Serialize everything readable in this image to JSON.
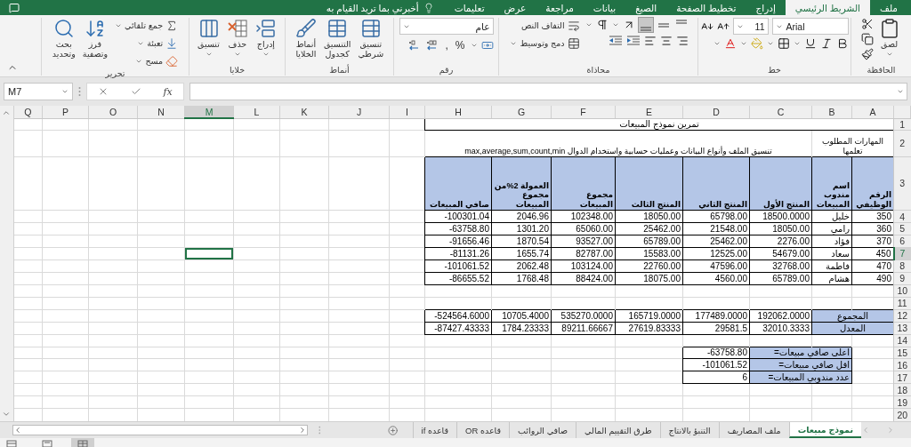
{
  "ribbon_tabs": [
    {
      "label": "ملف",
      "selected": false
    },
    {
      "label": "الشريط الرئيسي",
      "selected": true
    },
    {
      "label": "إدراج",
      "selected": false
    },
    {
      "label": "تخطيط الصفحة",
      "selected": false
    },
    {
      "label": "الصيغ",
      "selected": false
    },
    {
      "label": "بيانات",
      "selected": false
    },
    {
      "label": "مراجعة",
      "selected": false
    },
    {
      "label": "عرض",
      "selected": false
    },
    {
      "label": "تعليمات",
      "selected": false
    }
  ],
  "tell_me": "أخبرني بما تريد القيام به",
  "ribbon": {
    "clipboard": {
      "label": "الحافظة",
      "paste": "لصق"
    },
    "font": {
      "label": "خط",
      "name": "Arial",
      "size": "11"
    },
    "alignment": {
      "label": "محاذاة",
      "wrap": "التفاف النص",
      "merge": "دمج وتوسيط",
      "vertical_align": [
        {
          "selected": false
        },
        {
          "selected": false
        },
        {
          "selected": true
        }
      ]
    },
    "number": {
      "label": "رقم",
      "format": "عام",
      "percent": "%",
      "comma": ","
    },
    "styles": {
      "label": "أنماط",
      "buttons": [
        "تنسيق\nشرطي",
        "التنسيق\nكجدول",
        "أنماط\nالخلايا"
      ]
    },
    "cells": {
      "label": "خلايا",
      "buttons": [
        "إدراج",
        "حذف",
        "تنسيق"
      ]
    },
    "editing": {
      "label": "تحرير",
      "autosum": "جمع تلقائي",
      "fill": "تعبئة",
      "clear": "مسح",
      "sort": "فرز\nوتصفية",
      "find": "بحث\nوتحديد"
    }
  },
  "formula_bar": {
    "name_box": "M7",
    "fx": "fx"
  },
  "sheet": {
    "columns": [
      {
        "label": "A",
        "selected": false
      },
      {
        "label": "B",
        "selected": false
      },
      {
        "label": "C",
        "selected": false
      },
      {
        "label": "D",
        "selected": false
      },
      {
        "label": "E",
        "selected": false
      },
      {
        "label": "F",
        "selected": false
      },
      {
        "label": "G",
        "selected": false
      },
      {
        "label": "H",
        "selected": false
      },
      {
        "label": "I",
        "selected": false
      },
      {
        "label": "J",
        "selected": false
      },
      {
        "label": "K",
        "selected": false
      },
      {
        "label": "L",
        "selected": false
      },
      {
        "label": "M",
        "selected": true
      },
      {
        "label": "N",
        "selected": false
      },
      {
        "label": "O",
        "selected": false
      },
      {
        "label": "P",
        "selected": false
      },
      {
        "label": "Q",
        "selected": false
      }
    ],
    "rows": [
      {
        "label": "1",
        "selected": false
      },
      {
        "label": "2",
        "selected": false
      },
      {
        "label": "3",
        "selected": false
      },
      {
        "label": "4",
        "selected": false
      },
      {
        "label": "5",
        "selected": false
      },
      {
        "label": "6",
        "selected": false
      },
      {
        "label": "7",
        "selected": true
      },
      {
        "label": "8",
        "selected": false
      },
      {
        "label": "9",
        "selected": false
      },
      {
        "label": "10",
        "selected": false
      },
      {
        "label": "11",
        "selected": false
      },
      {
        "label": "12",
        "selected": false
      },
      {
        "label": "13",
        "selected": false
      },
      {
        "label": "14",
        "selected": false
      },
      {
        "label": "15",
        "selected": false
      },
      {
        "label": "16",
        "selected": false
      },
      {
        "label": "17",
        "selected": false
      },
      {
        "label": "18",
        "selected": false
      },
      {
        "label": "19",
        "selected": false
      },
      {
        "label": "20",
        "selected": false
      }
    ],
    "title": "تمرين نموذج المبيعات",
    "skills_label": "المهارات المطلوب تعلمها",
    "skills_text": "تنسيق الملف وأنواع البيانات وعمليات حسابية واستخدام الدوال max,average,sum,count,min",
    "headers": [
      "الرقم الوظيفي",
      "اسم مندوب المبيعات",
      "المنتج الأول",
      "المنتج الثاني",
      "المنتج الثالث",
      "مجموع المبيعات",
      "العمولة 2%من مجموع المبيعات",
      "صافي المبيعات"
    ],
    "data": [
      [
        "350",
        "خليل",
        "18500.0000",
        "65798.00",
        "18050.00",
        "102348.00",
        "2046.96",
        "-100301.04"
      ],
      [
        "360",
        "رامي",
        "18050.00",
        "21548.00",
        "25462.00",
        "65060.00",
        "1301.20",
        "-63758.80"
      ],
      [
        "370",
        "فؤاد",
        "2276.00",
        "25462.00",
        "65789.00",
        "93527.00",
        "1870.54",
        "-91656.46"
      ],
      [
        "450",
        "سعاد",
        "54679.00",
        "12525.00",
        "15583.00",
        "82787.00",
        "1655.74",
        "-81131.26"
      ],
      [
        "470",
        "فاطمة",
        "32768.00",
        "47596.00",
        "22760.00",
        "103124.00",
        "2062.48",
        "-101061.52"
      ],
      [
        "490",
        "هشام",
        "65789.00",
        "4560.00",
        "18075.00",
        "88424.00",
        "1768.48",
        "-86655.52"
      ]
    ],
    "totals": [
      {
        "label": "المجموع",
        "values": [
          "192062.0000",
          "177489.0000",
          "165719.0000",
          "535270.0000",
          "10705.4000",
          "-524564.6000"
        ]
      },
      {
        "label": "المعدل",
        "values": [
          "32010.3333",
          "29581.5",
          "27619.83333",
          "89211.66667",
          "1784.23333",
          "-87427.43333"
        ]
      }
    ],
    "summary": [
      {
        "label": "اعلى صافي مبيعات=",
        "value": "-63758.80"
      },
      {
        "label": "اقل صافي مبيعات=",
        "value": "-101061.52"
      },
      {
        "label": "عدد مندوبي المبيعات=",
        "value": "6"
      }
    ]
  },
  "sheet_tabs": [
    {
      "label": "نموذج مبيعات",
      "selected": true
    },
    {
      "label": "ملف المصاريف",
      "selected": false
    },
    {
      "label": "التنبؤ بالانتاج",
      "selected": false
    },
    {
      "label": "طرق التقييم المالي",
      "selected": false
    },
    {
      "label": "صافي الروائب",
      "selected": false
    },
    {
      "label": "قاعده OR",
      "selected": false
    },
    {
      "label": "قاعده if",
      "selected": false
    }
  ],
  "view_buttons": [
    {
      "selected": true
    },
    {
      "selected": false
    },
    {
      "selected": false
    }
  ]
}
